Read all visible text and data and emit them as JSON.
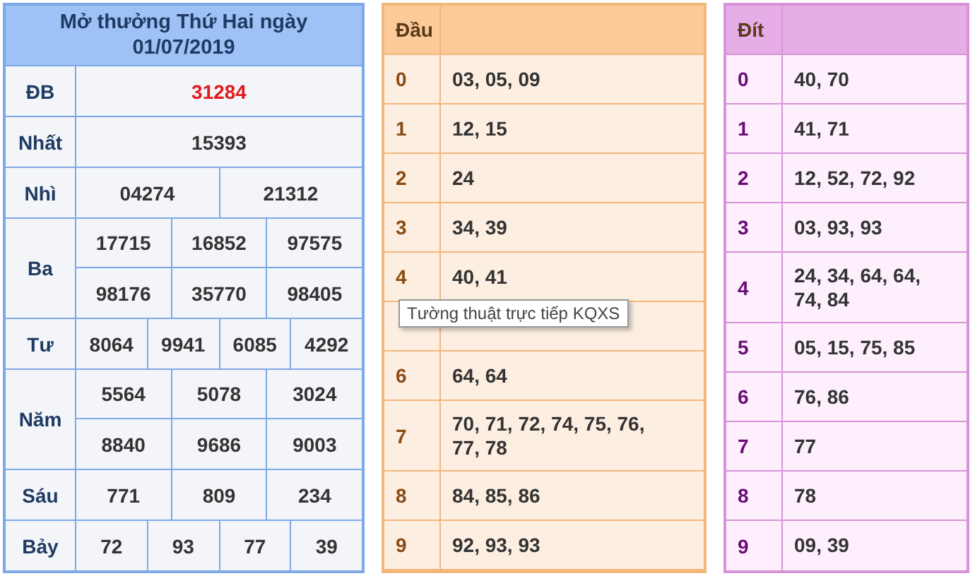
{
  "results": {
    "title": "Mở thưởng Thứ Hai ngày 01/07/2019",
    "prizes": [
      {
        "label": "ĐB",
        "kind": "special",
        "rows": [
          [
            "31284"
          ]
        ]
      },
      {
        "label": "Nhất",
        "kind": "normal",
        "rows": [
          [
            "15393"
          ]
        ]
      },
      {
        "label": "Nhì",
        "kind": "normal",
        "rows": [
          [
            "04274",
            "21312"
          ]
        ]
      },
      {
        "label": "Ba",
        "kind": "normal",
        "rows": [
          [
            "17715",
            "16852",
            "97575"
          ],
          [
            "98176",
            "35770",
            "98405"
          ]
        ]
      },
      {
        "label": "Tư",
        "kind": "normal",
        "rows": [
          [
            "8064",
            "9941",
            "6085",
            "4292"
          ]
        ]
      },
      {
        "label": "Năm",
        "kind": "normal",
        "rows": [
          [
            "5564",
            "5078",
            "3024"
          ],
          [
            "8840",
            "9686",
            "9003"
          ]
        ]
      },
      {
        "label": "Sáu",
        "kind": "normal",
        "rows": [
          [
            "771",
            "809",
            "234"
          ]
        ]
      },
      {
        "label": "Bảy",
        "kind": "normal",
        "rows": [
          [
            "72",
            "93",
            "77",
            "39"
          ]
        ]
      }
    ]
  },
  "dau": {
    "heading": "Đầu",
    "rows": [
      {
        "digit": "0",
        "numbers": "03, 05, 09"
      },
      {
        "digit": "1",
        "numbers": "12, 15"
      },
      {
        "digit": "2",
        "numbers": "24"
      },
      {
        "digit": "3",
        "numbers": "34, 39"
      },
      {
        "digit": "4",
        "numbers": "40, 41"
      },
      {},
      {
        "digit": "6",
        "numbers": "64, 64"
      },
      {
        "digit": "7",
        "numbers": "70, 71, 72, 74, 75, 76, 77, 78"
      },
      {
        "digit": "8",
        "numbers": "84, 85, 86"
      },
      {
        "digit": "9",
        "numbers": "92, 93, 93"
      }
    ]
  },
  "dit": {
    "heading": "Đít",
    "rows": [
      {
        "digit": "0",
        "numbers": "40, 70"
      },
      {
        "digit": "1",
        "numbers": "41, 71"
      },
      {
        "digit": "2",
        "numbers": "12, 52, 72, 92"
      },
      {
        "digit": "3",
        "numbers": "03, 93, 93"
      },
      {
        "digit": "4",
        "numbers": "24, 34, 64, 64, 74, 84"
      },
      {
        "digit": "5",
        "numbers": "05, 15, 75, 85"
      },
      {
        "digit": "6",
        "numbers": "76, 86"
      },
      {
        "digit": "7",
        "numbers": "77"
      },
      {
        "digit": "8",
        "numbers": "78"
      },
      {
        "digit": "9",
        "numbers": "09, 39"
      }
    ]
  },
  "tooltip": {
    "text": "Tường thuật trực tiếp KQXS"
  }
}
